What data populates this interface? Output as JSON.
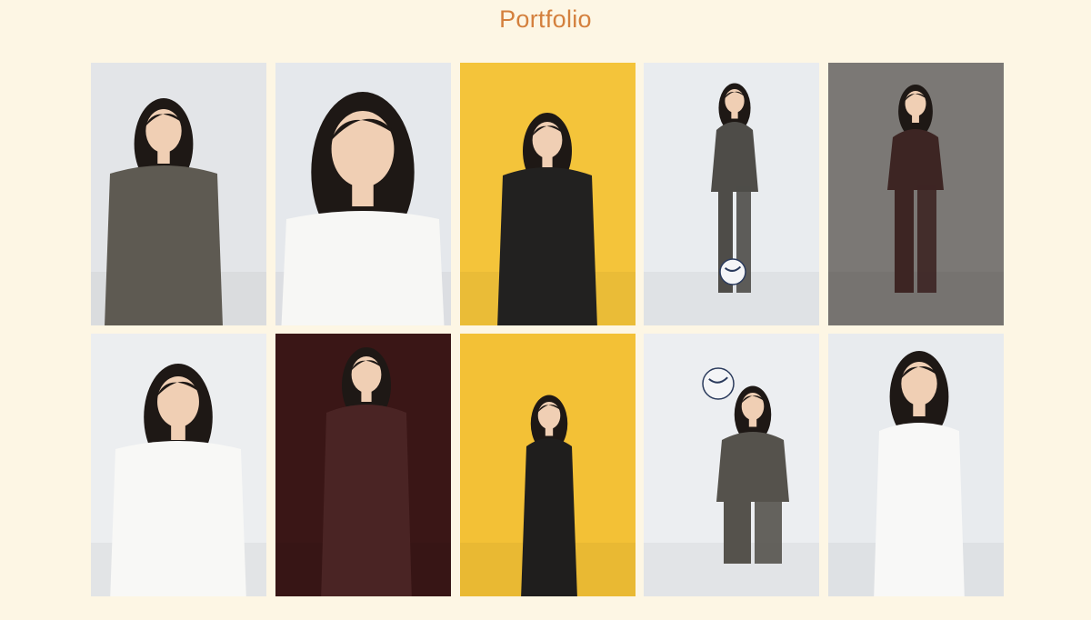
{
  "page": {
    "title": "Portfolio"
  },
  "colors": {
    "background": "#fdf6e4",
    "title": "#d4803d"
  },
  "gallery": {
    "photos": [
      {
        "name": "photo-1",
        "background": "#e3e5e8",
        "outfit": "#5e5a52",
        "pose": "seated-hands-chin"
      },
      {
        "name": "photo-2",
        "background": "#e5e8ec",
        "outfit": "#f7f7f5",
        "pose": "closeup-smile"
      },
      {
        "name": "photo-3",
        "background": "#f4c43a",
        "outfit": "#222120",
        "pose": "peace-sign"
      },
      {
        "name": "photo-4",
        "background": "#e9ecef",
        "outfit": "#4e4c48",
        "pose": "juggling-ball"
      },
      {
        "name": "photo-5",
        "background": "#7b7875",
        "outfit": "#3d2523",
        "pose": "hands-on-hips"
      },
      {
        "name": "photo-6",
        "background": "#eceef0",
        "outfit": "#f8f8f6",
        "pose": "half-body"
      },
      {
        "name": "photo-7",
        "background": "#3a1616",
        "outfit": "#4a2424",
        "pose": "hand-in-pocket"
      },
      {
        "name": "photo-8",
        "background": "#f3c136",
        "outfit": "#1f1e1d",
        "pose": "standing-full"
      },
      {
        "name": "photo-9",
        "background": "#eceef1",
        "outfit": "#55524c",
        "pose": "ball-on-head"
      },
      {
        "name": "photo-10",
        "background": "#e8ebee",
        "outfit": "#f8f8f7",
        "pose": "standing-white-shirt"
      }
    ]
  }
}
